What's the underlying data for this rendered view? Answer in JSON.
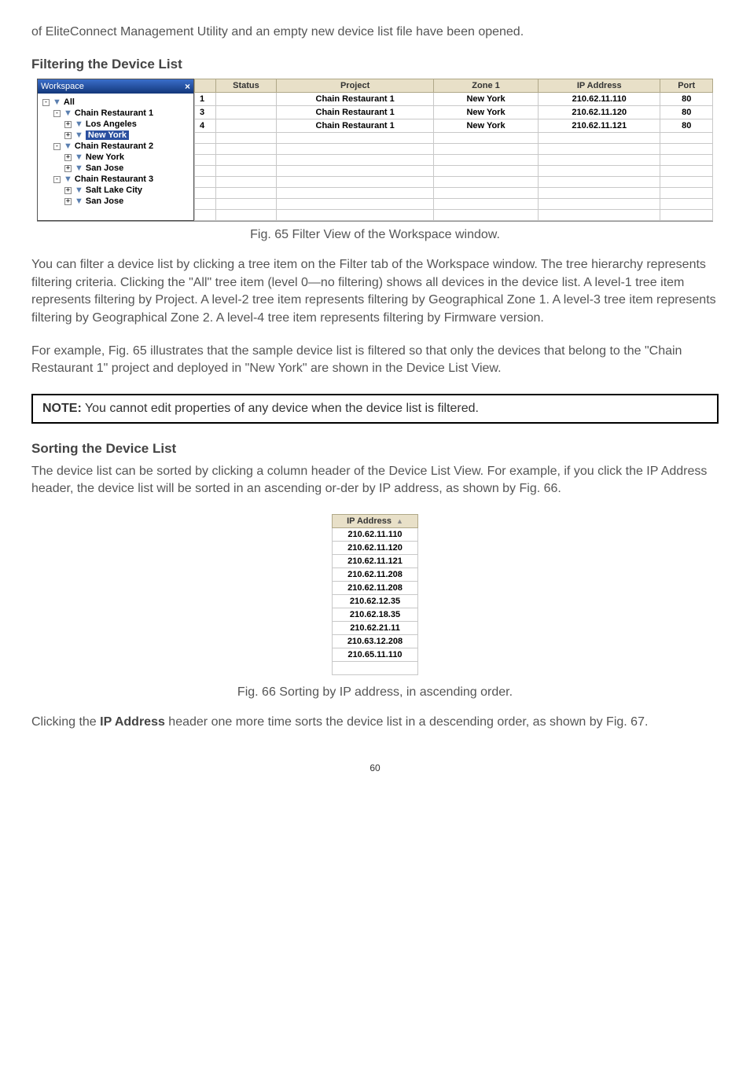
{
  "intro": "of EliteConnect Management Utility and an empty new device list file have been opened.",
  "heading_filter": "Filtering the Device List",
  "workspace": {
    "title": "Workspace",
    "close": "×",
    "tree": {
      "all": "All",
      "cr1": "Chain Restaurant 1",
      "la": "Los Angeles",
      "ny": "New York",
      "cr2": "Chain Restaurant 2",
      "ny2": "New York",
      "sj2": "San Jose",
      "cr3": "Chain Restaurant 3",
      "slc": "Salt Lake City",
      "sj3": "San Jose"
    },
    "columns": {
      "num": "",
      "status": "Status",
      "project": "Project",
      "zone1": "Zone 1",
      "ip": "IP Address",
      "port": "Port"
    },
    "rows": [
      {
        "n": "1",
        "project": "Chain Restaurant 1",
        "zone": "New York",
        "ip": "210.62.11.110",
        "port": "80"
      },
      {
        "n": "3",
        "project": "Chain Restaurant 1",
        "zone": "New York",
        "ip": "210.62.11.120",
        "port": "80"
      },
      {
        "n": "4",
        "project": "Chain Restaurant 1",
        "zone": "New York",
        "ip": "210.62.11.121",
        "port": "80"
      }
    ]
  },
  "fig65": "Fig. 65 Filter View of the Workspace window.",
  "para1": "You can filter a device list by clicking a tree item on the Filter tab of the Workspace window. The tree hierarchy represents filtering criteria. Clicking the \"All\" tree item (level 0—no filtering) shows all devices in the device list. A level-1 tree item represents filtering by Project. A level-2 tree item represents filtering by Geographical Zone 1. A level-3 tree item represents filtering by Geographical Zone 2. A level-4 tree item represents filtering by Firmware version.",
  "para2": "For example, Fig. 65 illustrates that the sample device list is filtered so that only the devices that belong to the \"Chain Restaurant 1\" project and deployed in \"New York\" are shown in the Device List View.",
  "note_label": "NOTE:",
  "note_text": " You cannot edit properties of any device when the device list is filtered.",
  "heading_sort": "Sorting the Device List",
  "para3": "The device list can be sorted by clicking a column header of the Device List View. For example, if you click the IP Address header, the device list will be sorted in an ascending or-der by IP address, as shown by Fig. 66.",
  "ip_sort": {
    "header": "IP Address",
    "rows": [
      "210.62.11.110",
      "210.62.11.120",
      "210.62.11.121",
      "210.62.11.208",
      "210.62.11.208",
      "210.62.12.35",
      "210.62.18.35",
      "210.62.21.11",
      "210.63.12.208",
      "210.65.11.110"
    ]
  },
  "fig66": "Fig. 66 Sorting by IP address, in ascending order.",
  "para4_pre": "Clicking the ",
  "para4_bold": "IP Address",
  "para4_post": " header one more time sorts the device list in a descending order, as shown by Fig. 67.",
  "page_num": "60"
}
